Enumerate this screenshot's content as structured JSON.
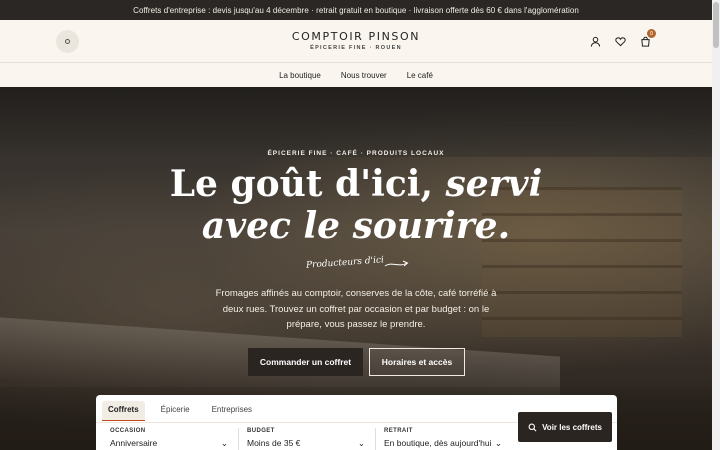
{
  "announcement": "Coffrets d'entreprise : devis jusqu'au 4 décembre · retrait gratuit en boutique · livraison offerte dès 60 € dans l'agglomération",
  "brand": {
    "name": "COMPTOIR PINSON",
    "tagline": "ÉPICERIE FINE · ROUEN"
  },
  "header": {
    "cart_count": "0"
  },
  "nav": [
    "La boutique",
    "Nous trouver",
    "Le café"
  ],
  "hero": {
    "eyebrow": "ÉPICERIE FINE · CAFÉ · PRODUITS LOCAUX",
    "headline_line1": "Le goût d'ici, ",
    "headline_em": "servi",
    "headline_line2": "avec le sourire.",
    "script_note": "Producteurs d'ici",
    "lede": "Fromages affinés au comptoir, conserves de la côte, café torréfié à deux rues. Trouvez un coffret par occasion et par budget : on le prépare, vous passez le prendre.",
    "cta_primary": "Commander un coffret",
    "cta_secondary": "Horaires et accès"
  },
  "finder": {
    "tabs": [
      "Coffrets",
      "Épicerie",
      "Entreprises"
    ],
    "active_tab": "Coffrets",
    "fields": [
      {
        "label": "OCCASION",
        "value": "Anniversaire"
      },
      {
        "label": "BUDGET",
        "value": "Moins de 35 €"
      },
      {
        "label": "RETRAIT",
        "value": "En boutique, dès aujourd'hui"
      }
    ],
    "submit": "Voir les coffrets"
  },
  "colors": {
    "accent": "#c04a1e",
    "dark": "#2b2522",
    "cream": "#faf6ef",
    "badge": "#b0652c"
  }
}
